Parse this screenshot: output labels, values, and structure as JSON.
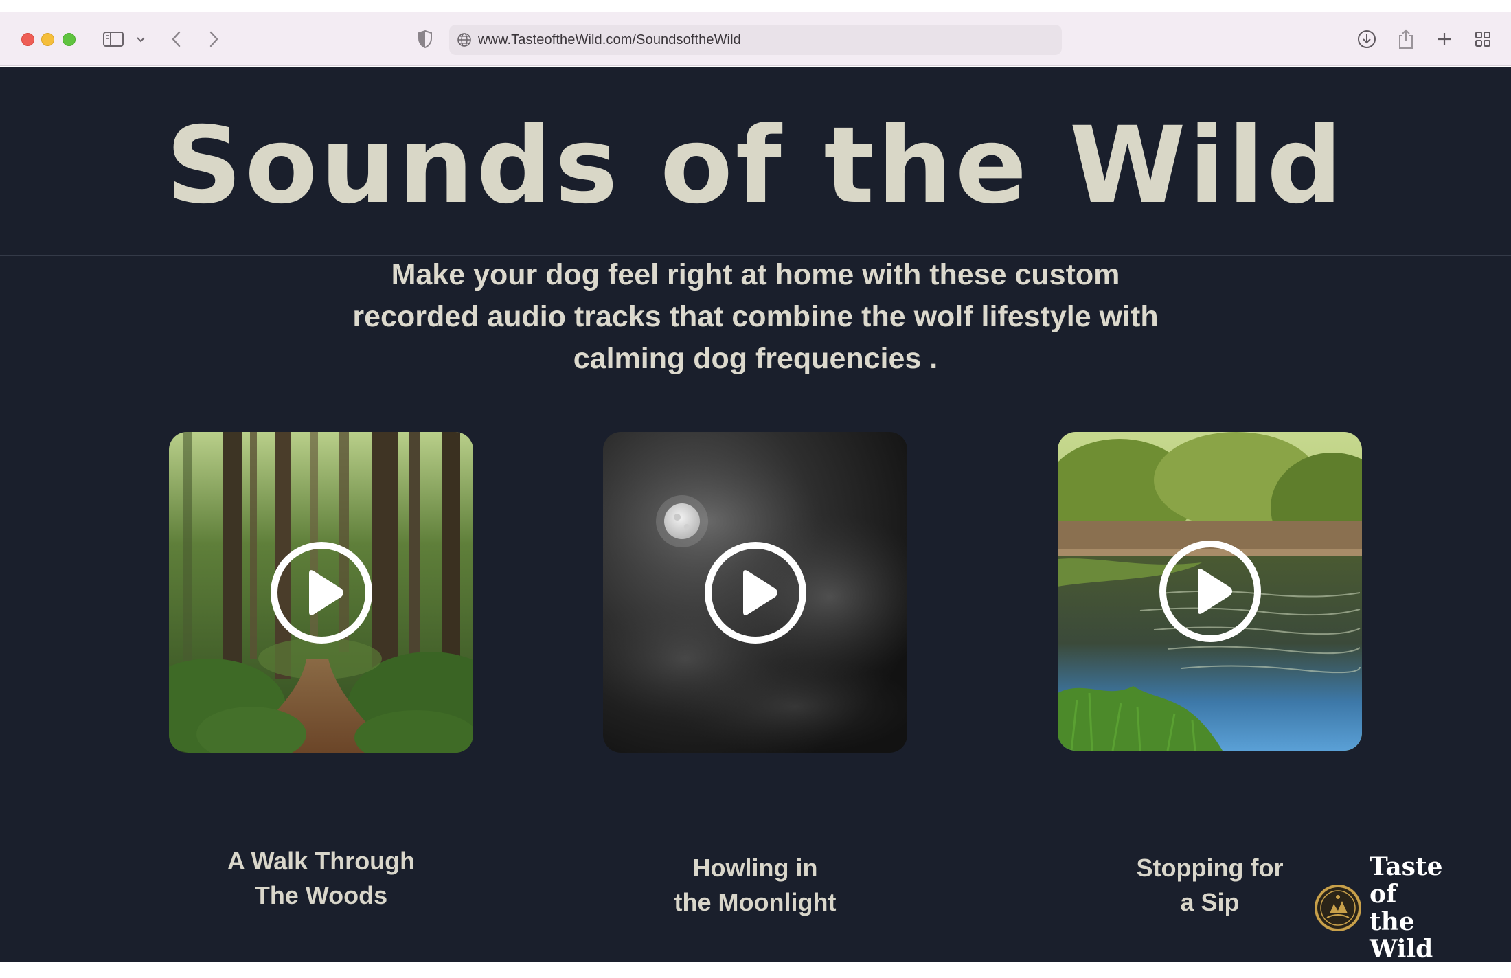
{
  "browser": {
    "url": "www.TasteoftheWild.com/SoundsoftheWild"
  },
  "page": {
    "title": "Sounds of the Wild",
    "subtitle": "Make your dog feel right at home with these custom recorded audio tracks that combine the wolf lifestyle with calming dog frequencies ."
  },
  "tracks": [
    {
      "title_line1": "A Walk Through",
      "title_line2": "The Woods",
      "scene": "forest"
    },
    {
      "title_line1": "Howling in",
      "title_line2": "the Moonlight",
      "scene": "moon"
    },
    {
      "title_line1": "Stopping for",
      "title_line2": "a Sip",
      "scene": "pond"
    }
  ],
  "brand": {
    "line1": "Taste of",
    "line2": "the Wild"
  },
  "colors": {
    "page_background": "#1a1f2c",
    "title_text": "#d9d7c7",
    "body_text": "#dcd9cd"
  },
  "icons": [
    "sidebar-icon",
    "chevron-down-icon",
    "back-icon",
    "forward-icon",
    "shield-icon",
    "globe-icon",
    "download-icon",
    "share-icon",
    "plus-icon",
    "tab-overview-icon",
    "play-icon"
  ]
}
